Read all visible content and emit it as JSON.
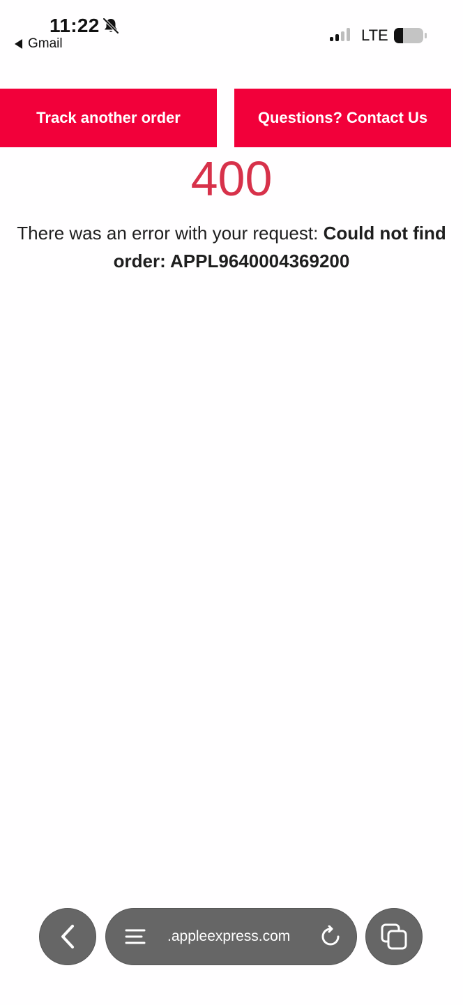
{
  "status_bar": {
    "time": "11:22",
    "back_app": "Gmail",
    "network": "LTE",
    "icons": [
      "bell-slash-icon",
      "signal-icon",
      "battery-icon"
    ]
  },
  "actions": {
    "track_label": "Track another order",
    "contact_label": "Questions? Contact Us"
  },
  "error": {
    "code": "400",
    "message_prefix": "There was an error with your request: ",
    "message_detail": "Could not find order: APPL9640004369200"
  },
  "browser": {
    "url": ".appleexpress.com",
    "icons": [
      "chevron-left-icon",
      "menu-icon",
      "reload-icon",
      "tabs-icon"
    ]
  },
  "colors": {
    "accent": "#f2003a",
    "error_code": "#d7314a",
    "toolbar": "#666666"
  }
}
